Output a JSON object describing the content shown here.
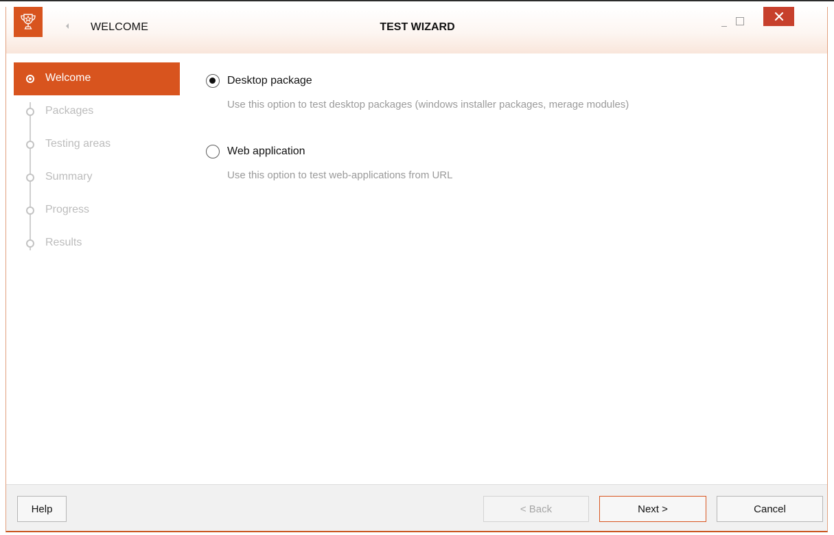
{
  "titlebar": {
    "breadcrumb": "WELCOME",
    "title": "TEST WIZARD",
    "icons": [
      "trophy-icon",
      "back-arrow-icon",
      "minimize-icon",
      "maximize-icon",
      "close-icon"
    ]
  },
  "sidebar": {
    "steps": [
      {
        "label": "Welcome",
        "active": true
      },
      {
        "label": "Packages",
        "active": false
      },
      {
        "label": "Testing areas",
        "active": false
      },
      {
        "label": "Summary",
        "active": false
      },
      {
        "label": "Progress",
        "active": false
      },
      {
        "label": "Results",
        "active": false
      }
    ]
  },
  "options": [
    {
      "label": "Desktop package",
      "description": "Use this option to test desktop packages (windows installer packages, merage modules)",
      "selected": true
    },
    {
      "label": "Web application",
      "description": "Use this option to test web-applications from URL",
      "selected": false
    }
  ],
  "footer": {
    "help": "Help",
    "back": "< Back",
    "next": "Next >",
    "cancel": "Cancel"
  },
  "colors": {
    "accent": "#d8541e",
    "close": "#c7402c"
  }
}
